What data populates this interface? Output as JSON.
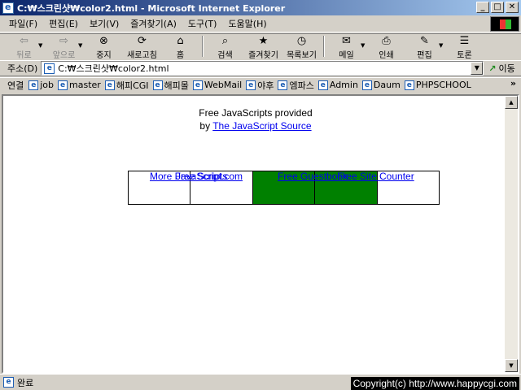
{
  "window": {
    "title": "C:₩스크린샷₩color2.html - Microsoft Internet Explorer",
    "icon": "ie-icon",
    "controls": [
      "_",
      "□",
      "✕"
    ]
  },
  "menu": [
    "파일(F)",
    "편집(E)",
    "보기(V)",
    "즐겨찾기(A)",
    "도구(T)",
    "도움말(H)"
  ],
  "toolbar": {
    "back": "뒤로",
    "forward": "앞으로",
    "stop": "중지",
    "refresh": "새로고침",
    "home": "홈",
    "search": "검색",
    "favorites": "즐겨찾기",
    "history": "목록보기",
    "mail": "메일",
    "print": "인쇄",
    "edit": "편집",
    "discuss": "토론"
  },
  "address": {
    "label": "주소(D)",
    "value": "C:₩스크린샷₩color2.html",
    "go": "이동"
  },
  "links": {
    "label": "연결",
    "items": [
      "job",
      "master",
      "해피CGI",
      "해피몰",
      "WebMail",
      "야후",
      "엠파스",
      "Admin",
      "Daum",
      "PHPSCHOOL"
    ]
  },
  "page": {
    "credit_line1": "Free JavaScripts provided",
    "credit_by": "by",
    "credit_link": "The JavaScript Source",
    "cells": [
      {
        "link": "More Free Scripts",
        "bg": "#ffffff"
      },
      {
        "link": "JavaScript.com",
        "bg": "#ffffff"
      },
      {
        "link": "Free Guestbook",
        "bg": "#008000"
      },
      {
        "link": "Free Site Counter",
        "bg": "#008000"
      },
      {
        "link": "",
        "bg": "#ffffff"
      }
    ]
  },
  "status": {
    "text": "완료",
    "copyright": "Copyright(c) http://www.happycgi.com"
  },
  "colors": {
    "titlebar_start": "#0a246a",
    "titlebar_end": "#a6caf0",
    "chrome": "#d4d0c8",
    "link": "#0000ee",
    "cell_green": "#008000"
  }
}
